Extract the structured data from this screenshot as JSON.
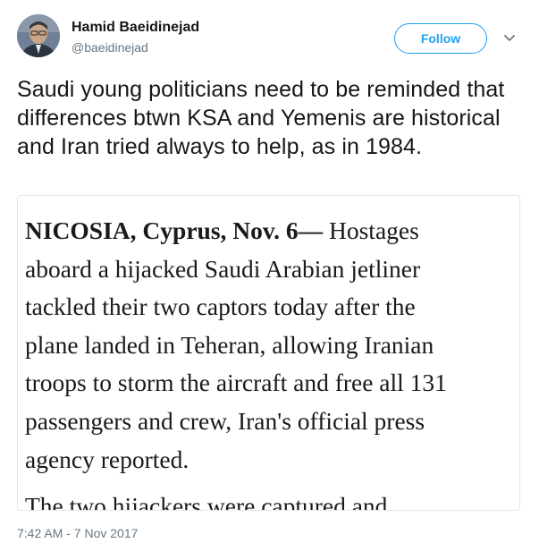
{
  "user": {
    "display_name": "Hamid Baeidinejad",
    "handle": "@baeidinejad"
  },
  "actions": {
    "follow_label": "Follow",
    "menu_icon": "chevron-down-icon"
  },
  "tweet": {
    "text": "Saudi young politicians need to be reminded that differences btwn KSA and Yemenis are historical and Iran tried always to help, as in 1984.",
    "timestamp": "7:42 AM - 7 Nov 2017"
  },
  "media": {
    "dateline": "NICOSIA, Cyprus, Nov. 6—",
    "line1_rest": " Hostages",
    "lines": [
      "aboard a hijacked Saudi Arabian jetliner",
      "tackled their two captors today after the",
      "plane landed in Teheran, allowing Iranian",
      "troops to storm the aircraft and free all 131",
      "passengers and crew, Iran's official press",
      "agency reported."
    ],
    "cutoff_line": "The two hijackers were captured and"
  },
  "colors": {
    "accent": "#1da1f2",
    "text": "#14171a",
    "secondary": "#657786",
    "border": "#e1e8ed"
  }
}
